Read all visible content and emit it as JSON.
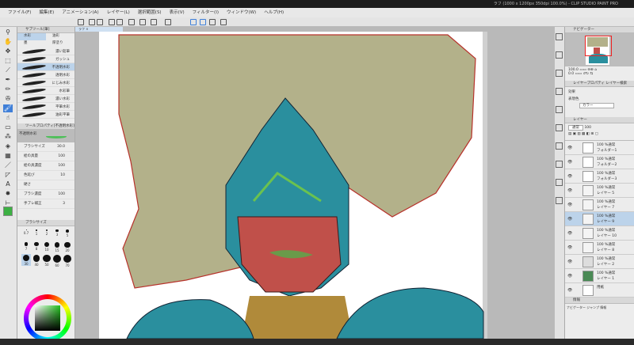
{
  "window": {
    "title": "ラフ (1000 x 1200px 350dpi 100.0%) - CLIP STUDIO PAINT PRO"
  },
  "menu": [
    "ファイル(F)",
    "編集(E)",
    "アニメーション(A)",
    "レイヤー(L)",
    "選択範囲(S)",
    "表示(V)",
    "フィルター(I)",
    "ウィンドウ(W)",
    "ヘルプ(H)"
  ],
  "canvas_tab": "ラフ",
  "subtool": {
    "header": "サブツール[筆]",
    "groups": [
      "水彩",
      "油彩",
      "墨",
      "厚塗り"
    ],
    "brushes": [
      "濃い鉛筆",
      "ガッシュ",
      "不透明水彩",
      "透明水彩",
      "にじみ水彩",
      "水彩筆",
      "濃い水彩",
      "平筆水彩",
      "油彩平筆"
    ],
    "selected_index": 2
  },
  "tool_property": {
    "header": "ツールプロパティ[不透明水彩]",
    "preview_label": "不透明水彩",
    "rows": [
      {
        "label": "ブラシサイズ",
        "value": "30.0"
      },
      {
        "label": "絵の具量",
        "value": "100"
      },
      {
        "label": "絵の具濃度",
        "value": "100"
      },
      {
        "label": "色延び",
        "value": "10"
      },
      {
        "label": "硬さ",
        "value": ""
      },
      {
        "label": "ブラシ濃度",
        "value": "100"
      },
      {
        "label": "手ブレ補正",
        "value": "3"
      }
    ]
  },
  "brush_size": {
    "header": "ブラシサイズ",
    "values": [
      "0.7",
      "1",
      "2",
      "3",
      "5",
      "7",
      "8",
      "10",
      "15",
      "20",
      "30",
      "40",
      "50",
      "60",
      "70"
    ],
    "selected": "30"
  },
  "colors": {
    "main": "#3cb043",
    "sub": "#ffffff",
    "accent": "#3f7fd8"
  },
  "navigator": {
    "header": "ナビゲーター",
    "zoom": "100.0",
    "angle": "0.0"
  },
  "layer_property": {
    "tabs": [
      "レイヤープロパティ",
      "レイヤー検索"
    ],
    "effect_label": "効果",
    "expression_label": "表現色",
    "expression_value": "カラー"
  },
  "layers_panel": {
    "header": "レイヤー",
    "blend": "通常",
    "opacity": "100",
    "layers": [
      {
        "name": "100 %通常",
        "sub": "フォルダー1",
        "type": "folder"
      },
      {
        "name": "100 %通常",
        "sub": "フォルダー2",
        "type": "folder"
      },
      {
        "name": "100 %通常",
        "sub": "フォルダー3",
        "type": "folder"
      },
      {
        "name": "100 %通常",
        "sub": "レイヤー 5",
        "type": "layer"
      },
      {
        "name": "100 %通常",
        "sub": "レイヤー 7",
        "type": "layer"
      },
      {
        "name": "100 %通常",
        "sub": "レイヤー 9",
        "type": "layer",
        "selected": true
      },
      {
        "name": "100 %通常",
        "sub": "レイヤー 10",
        "type": "layer"
      },
      {
        "name": "100 %通常",
        "sub": "レイヤー 8",
        "type": "layer"
      },
      {
        "name": "100 %通常",
        "sub": "レイヤー 2",
        "type": "layer"
      },
      {
        "name": "100 %通常",
        "sub": "レイヤー 1",
        "type": "layer"
      },
      {
        "name": "用紙",
        "sub": "",
        "type": "paper"
      }
    ]
  },
  "info_panel": {
    "header": "情報",
    "tabs": "ヒストグラム",
    "row": "ナビゲーター ジャンプ 情報"
  }
}
